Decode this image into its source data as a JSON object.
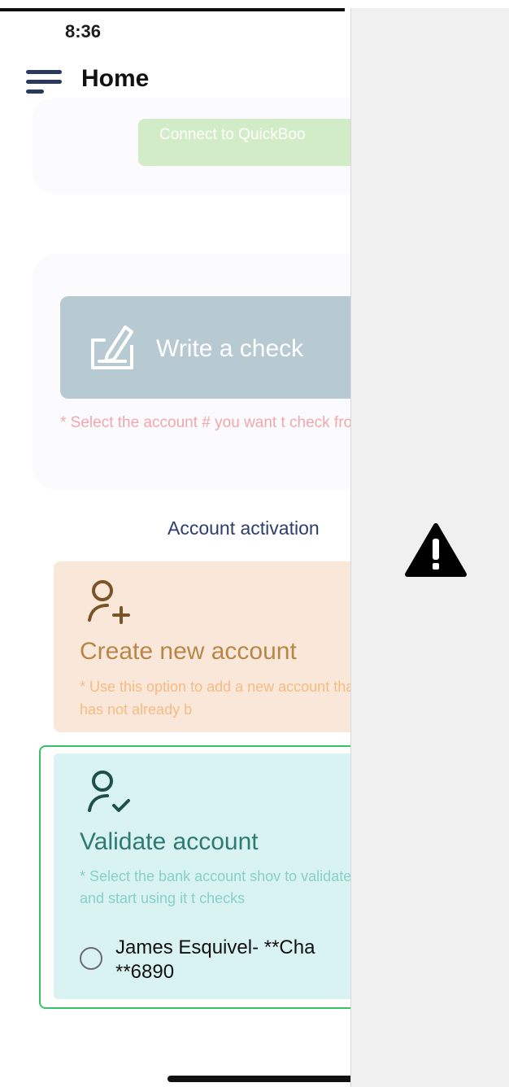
{
  "status_bar": {
    "time": "8:36"
  },
  "header": {
    "title": "Home",
    "menu_icon": "hamburger-menu-icon"
  },
  "quickbooks": {
    "button_label": "Connect to QuickBoo"
  },
  "write_check": {
    "button_label": "Write a check",
    "icon": "check-write-icon",
    "note": "* Select the account # you want t check from"
  },
  "activation": {
    "heading": "Account activation"
  },
  "create_account": {
    "icon": "person-add-icon",
    "title": "Create new account",
    "note": "* Use this option to add a new account that has not already b"
  },
  "validate_account": {
    "icon": "person-check-icon",
    "title": "Validate account",
    "note": "* Select the bank account shov to validate it and start using it t checks",
    "option_label": "James Esquivel- **Cha **6890"
  },
  "right_panel": {
    "icon": "warning-icon"
  },
  "colors": {
    "quickbooks_green": "#d2ecc8",
    "check_button": "#b7c9d1",
    "create_bg": "#f9e8da",
    "validate_bg": "#d8f3f1",
    "validate_border": "#38c168",
    "heading_navy": "#2d3e6e"
  }
}
